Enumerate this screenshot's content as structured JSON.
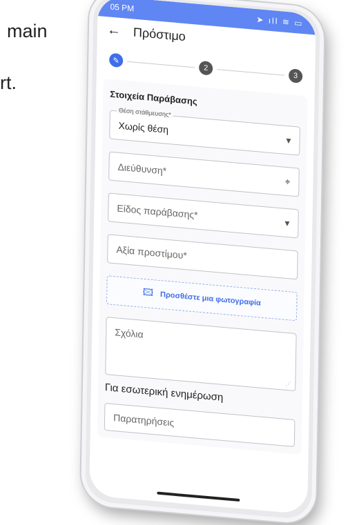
{
  "background": {
    "line1": "main",
    "line2": "rt."
  },
  "statusbar": {
    "time": "05 PM",
    "icons": "➤ ıll ≋ ▭"
  },
  "appbar": {
    "back_icon": "←",
    "title": "Πρόστιμο"
  },
  "stepper": {
    "step1": "✎",
    "step2": "2",
    "step3": "3"
  },
  "form": {
    "section_title": "Στοιχεία Παράβασης",
    "parking_label": "Θέση στάθμευσης*",
    "parking_value": "Χωρίς θέση",
    "address_placeholder": "Διεύθυνση*",
    "violation_type_placeholder": "Είδος παράβασης*",
    "fine_value_placeholder": "Αξία προστίμου*",
    "add_photo_label": "Προσθέστε μια φωτογραφία",
    "comments_placeholder": "Σχόλια",
    "internal_title": "Για εσωτερική ενημέρωση",
    "notes_placeholder": "Παρατηρήσεις"
  },
  "colors": {
    "accent": "#3f6ee8",
    "statusbar": "#5f86f3"
  }
}
